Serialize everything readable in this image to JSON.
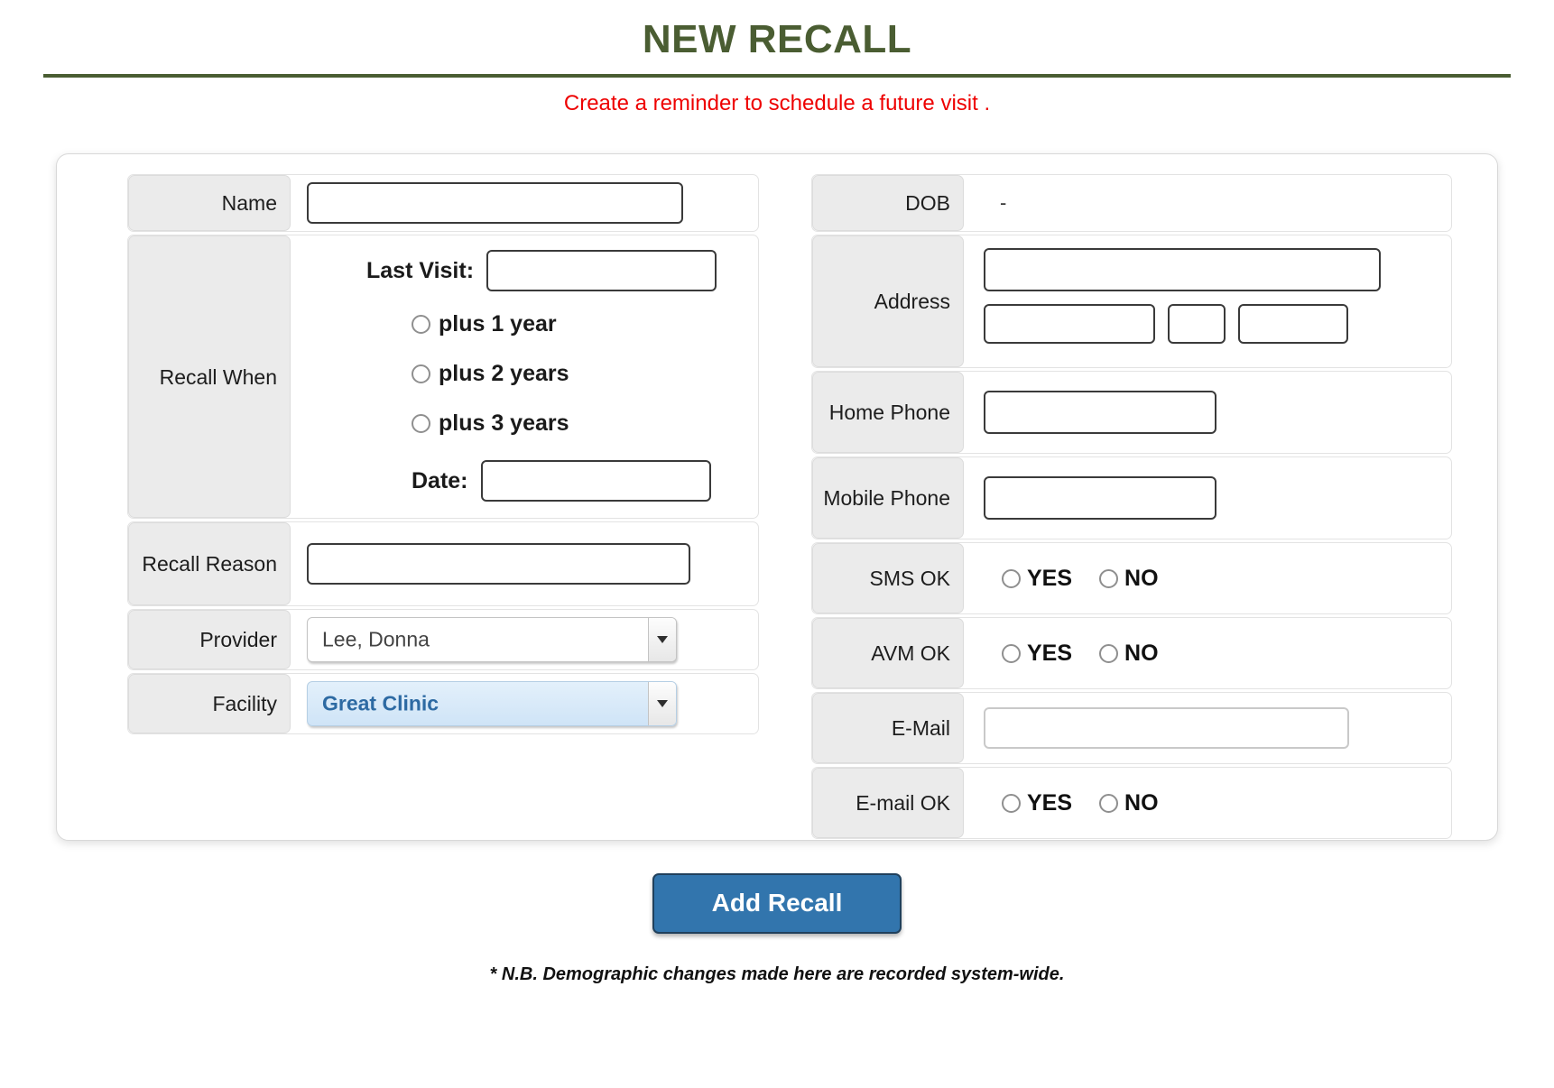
{
  "header": {
    "title": "NEW RECALL",
    "subtitle": "Create a reminder to schedule a future visit ."
  },
  "left_panel": {
    "name": {
      "label": "Name",
      "value": "",
      "placeholder": ""
    },
    "recall_when": {
      "label": "Recall When",
      "last_visit_label": "Last Visit:",
      "last_visit_value": "",
      "options": [
        {
          "label": "plus 1 year",
          "selected": false
        },
        {
          "label": "plus 2 years",
          "selected": false
        },
        {
          "label": "plus 3 years",
          "selected": false
        }
      ],
      "date_label": "Date:",
      "date_value": ""
    },
    "recall_reason": {
      "label": "Recall Reason",
      "value": ""
    },
    "provider": {
      "label": "Provider",
      "value": "Lee, Donna",
      "highlighted": false
    },
    "facility": {
      "label": "Facility",
      "value": "Great Clinic",
      "highlighted": true
    }
  },
  "right_panel": {
    "dob": {
      "label": "DOB",
      "value": "-"
    },
    "address": {
      "label": "Address",
      "street": "",
      "city": "",
      "state": "",
      "zip": ""
    },
    "home_phone": {
      "label": "Home Phone",
      "value": ""
    },
    "mobile_phone": {
      "label": "Mobile Phone",
      "value": ""
    },
    "sms_ok": {
      "label": "SMS OK",
      "yes_label": "YES",
      "no_label": "NO",
      "selected": null
    },
    "avm_ok": {
      "label": "AVM OK",
      "yes_label": "YES",
      "no_label": "NO",
      "selected": null
    },
    "email": {
      "label": "E-Mail",
      "value": ""
    },
    "email_ok": {
      "label": "E-mail OK",
      "yes_label": "YES",
      "no_label": "NO",
      "selected": null
    }
  },
  "footer": {
    "submit_label": "Add Recall",
    "note": "* N.B. Demographic changes made here are recorded system-wide."
  },
  "colors": {
    "title_green": "#4a5d32",
    "subtitle_red": "#ee0000",
    "button_blue": "#3275ad",
    "facility_highlight_text": "#2d6aa3",
    "label_cell_gray": "#ebebeb"
  }
}
